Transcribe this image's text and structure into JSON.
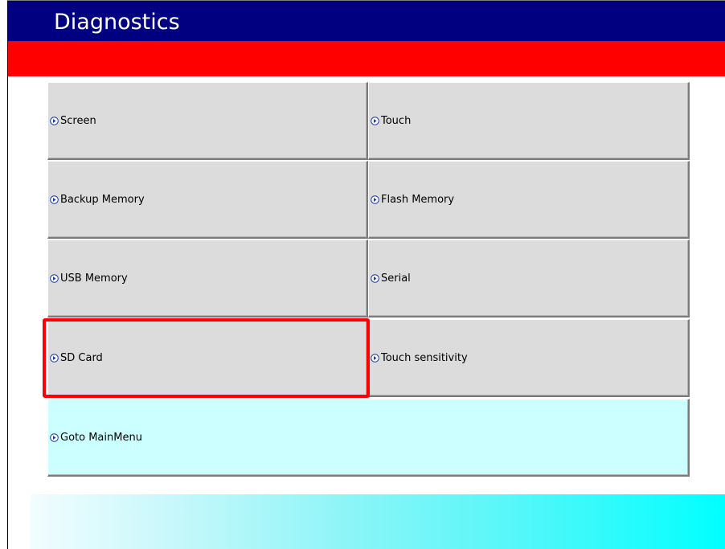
{
  "window": {
    "title": "Diagnostics"
  },
  "menu": {
    "items": [
      {
        "label": "Screen"
      },
      {
        "label": "Touch"
      },
      {
        "label": "Backup Memory"
      },
      {
        "label": "Flash Memory"
      },
      {
        "label": "USB Memory"
      },
      {
        "label": "Serial"
      },
      {
        "label": "SD Card"
      },
      {
        "label": "Touch sensitivity"
      }
    ],
    "main_menu_label": "Goto MainMenu",
    "item_icon": "right-arrow-circle-icon",
    "highlighted_item": "SD Card"
  },
  "colors": {
    "title_bar": "#000080",
    "accent_bar": "#ff0000",
    "button_face": "#dcdcdc",
    "main_menu_button": "#ccffff",
    "highlight": "#ff0000",
    "gradient_start": "#f2fdff",
    "gradient_end": "#00ffff"
  }
}
